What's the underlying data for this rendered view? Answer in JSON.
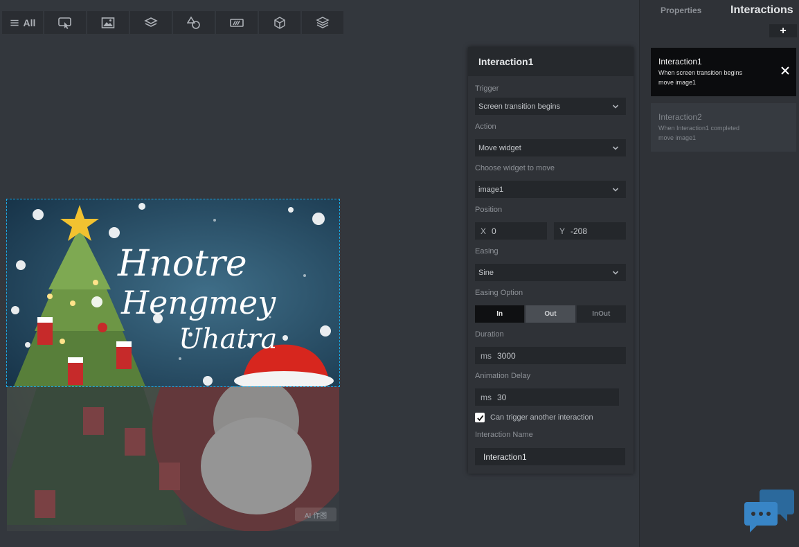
{
  "toolbar": {
    "all_label": "All",
    "buttons": [
      "interaction-icon",
      "image-icon",
      "layers-icon",
      "shapes-icon",
      "gallery-icon",
      "cube-icon",
      "stack-icon"
    ]
  },
  "canvas": {
    "ai_badge": "AI 作图",
    "card_text": "Hnotre Hengmey Uhatra"
  },
  "editor": {
    "title": "Interaction1",
    "trigger_label": "Trigger",
    "trigger_value": "Screen transition begins",
    "action_label": "Action",
    "action_value": "Move widget",
    "widget_label": "Choose widget to move",
    "widget_value": "image1",
    "position_label": "Position",
    "pos_x_label": "X",
    "pos_x_value": "0",
    "pos_y_label": "Y",
    "pos_y_value": "-208",
    "easing_label": "Easing",
    "easing_value": "Sine",
    "easing_option_label": "Easing Option",
    "easing_options": [
      "In",
      "Out",
      "InOut"
    ],
    "duration_label": "Duration",
    "duration_unit": "ms",
    "duration_value": "3000",
    "delay_label": "Animation Delay",
    "delay_unit": "ms",
    "delay_value": "30",
    "can_trigger_label": "Can trigger another interaction",
    "name_label": "Interaction Name",
    "name_value": "Interaction1"
  },
  "right_panel": {
    "tab_properties": "Properties",
    "tab_interactions": "Interactions",
    "add_label": "+",
    "interactions": [
      {
        "title": "Interaction1",
        "line1": "When screen transition begins",
        "line2": "move image1"
      },
      {
        "title": "Interaction2",
        "line1": "When Interaction1 completed",
        "line2": "move image1"
      }
    ]
  },
  "colors": {
    "background": "#33373d",
    "panel": "#2f3237",
    "selection_outline": "#19a9e6",
    "active_card": "#0b0c0e"
  }
}
